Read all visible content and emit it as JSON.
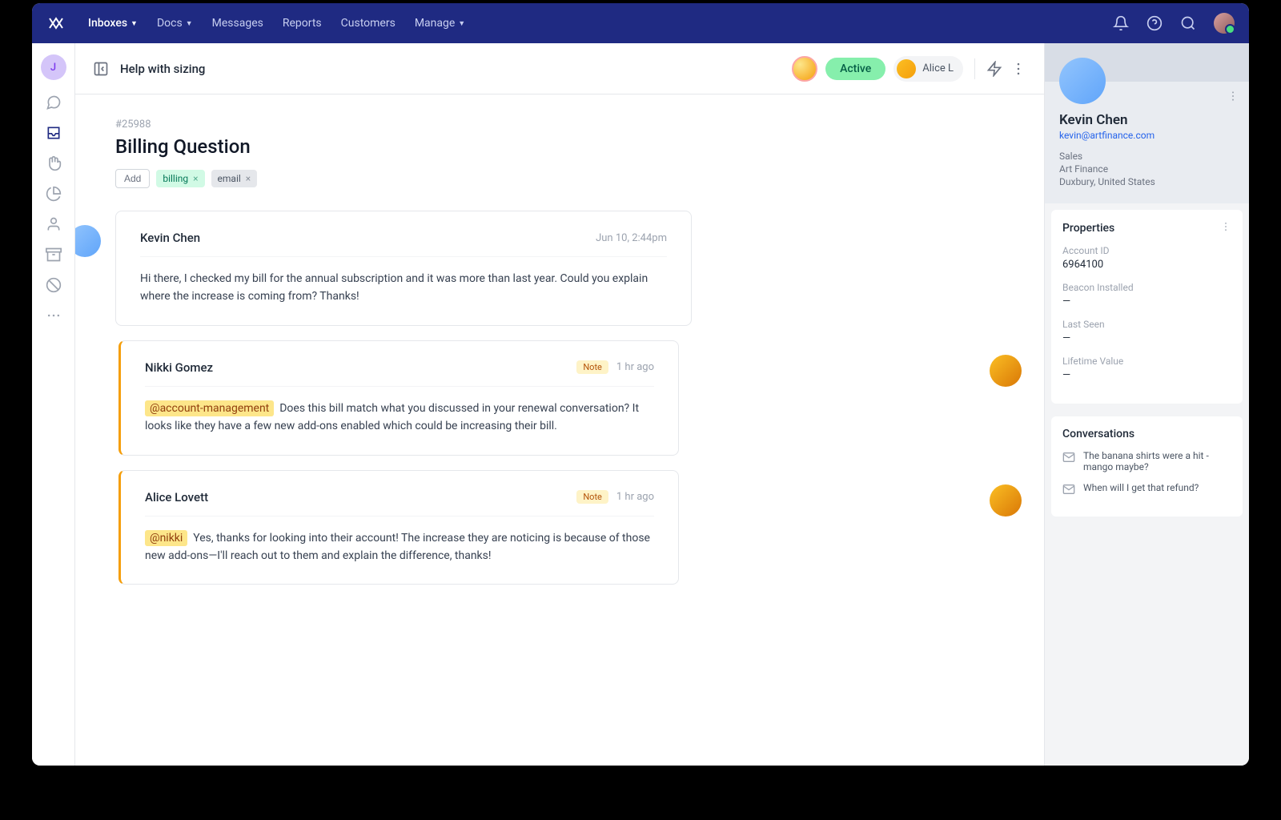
{
  "nav": {
    "items": [
      "Inboxes",
      "Docs",
      "Messages",
      "Reports",
      "Customers",
      "Manage"
    ],
    "active_index": 0
  },
  "rail": {
    "avatar_letter": "J"
  },
  "conversation": {
    "header_title": "Help with sizing",
    "status": "Active",
    "assignee": "Alice L",
    "ticket_id": "#25988",
    "title": "Billing Question",
    "tags": {
      "add_label": "Add",
      "items": [
        "billing",
        "email"
      ]
    },
    "messages": [
      {
        "author": "Kevin Chen",
        "timestamp": "Jun 10, 2:44pm",
        "is_note": false,
        "side": "left",
        "mention": null,
        "body": "Hi there, I checked my bill for the annual subscription and it was more than last year. Could you explain where the increase is coming from? Thanks!"
      },
      {
        "author": "Nikki Gomez",
        "timestamp": "1 hr ago",
        "is_note": true,
        "side": "right",
        "note_label": "Note",
        "mention": "@account-management",
        "body": "Does this bill match what you discussed in your renewal conversation? It looks like they have a few new add-ons enabled which could be increasing their bill."
      },
      {
        "author": "Alice Lovett",
        "timestamp": "1 hr ago",
        "is_note": true,
        "side": "right",
        "note_label": "Note",
        "mention": "@nikki",
        "body": "Yes, thanks for looking into their account! The increase they are noticing is because of those new add-ons—I'll reach out to them and explain the difference, thanks!"
      }
    ]
  },
  "customer": {
    "name": "Kevin Chen",
    "email": "kevin@artfinance.com",
    "department": "Sales",
    "company": "Art Finance",
    "location": "Duxbury, United States",
    "properties_title": "Properties",
    "properties": [
      {
        "label": "Account ID",
        "value": "6964100"
      },
      {
        "label": "Beacon Installed",
        "value": "—"
      },
      {
        "label": "Last Seen",
        "value": "—"
      },
      {
        "label": "Lifetime Value",
        "value": "—"
      }
    ],
    "conversations_title": "Conversations",
    "conversations": [
      "The banana shirts were a hit - mango maybe?",
      "When will I get that refund?"
    ]
  }
}
